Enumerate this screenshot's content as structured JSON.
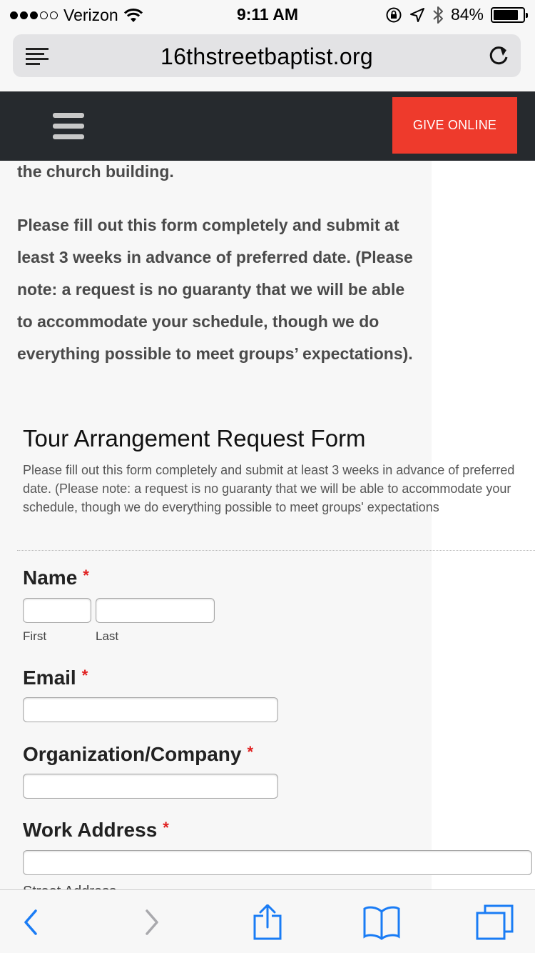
{
  "status_bar": {
    "carrier": "Verizon",
    "time": "9:11 AM",
    "battery": "84%",
    "battery_level": 0.84,
    "icons": [
      "signal-dots",
      "wifi-icon",
      "rotation-lock-icon",
      "location-icon",
      "bluetooth-icon",
      "battery-icon"
    ]
  },
  "browser": {
    "url": "16thstreetbaptist.org",
    "icons": [
      "reader-icon",
      "reload-icon"
    ]
  },
  "header": {
    "give_label": "GIVE ONLINE",
    "menu_icon": "hamburger-icon",
    "colors": {
      "bar": "#262a2e",
      "give": "#ee3a2c"
    }
  },
  "intro": {
    "top_text": "the church building.",
    "body": "Please fill out this form completely and submit at least 3 weeks in advance of preferred date. (Please note: a request is no guaranty that we will be able to accommodate your schedule, though we do everything possible to meet groups’ expectations)."
  },
  "form": {
    "title": "Tour Arrangement Request Form",
    "description": "Please fill out this form completely and submit at least 3 weeks in advance of preferred date. (Please note: a request is no guaranty that we will be able to accommodate your schedule, though we do everything possible to meet groups' expectations",
    "required_mark": "*",
    "fields": {
      "name": {
        "label": "Name",
        "first_label": "First",
        "last_label": "Last",
        "first_value": "",
        "last_value": ""
      },
      "email": {
        "label": "Email",
        "value": ""
      },
      "organization": {
        "label": "Organization/Company",
        "value": ""
      },
      "work_address": {
        "label": "Work Address",
        "value": "",
        "street_label": "Street Address"
      }
    }
  },
  "toolbar": {
    "icons": [
      "back-icon",
      "forward-icon",
      "share-icon",
      "bookmarks-icon",
      "tabs-icon"
    ],
    "accent": "#1a7cf5"
  }
}
